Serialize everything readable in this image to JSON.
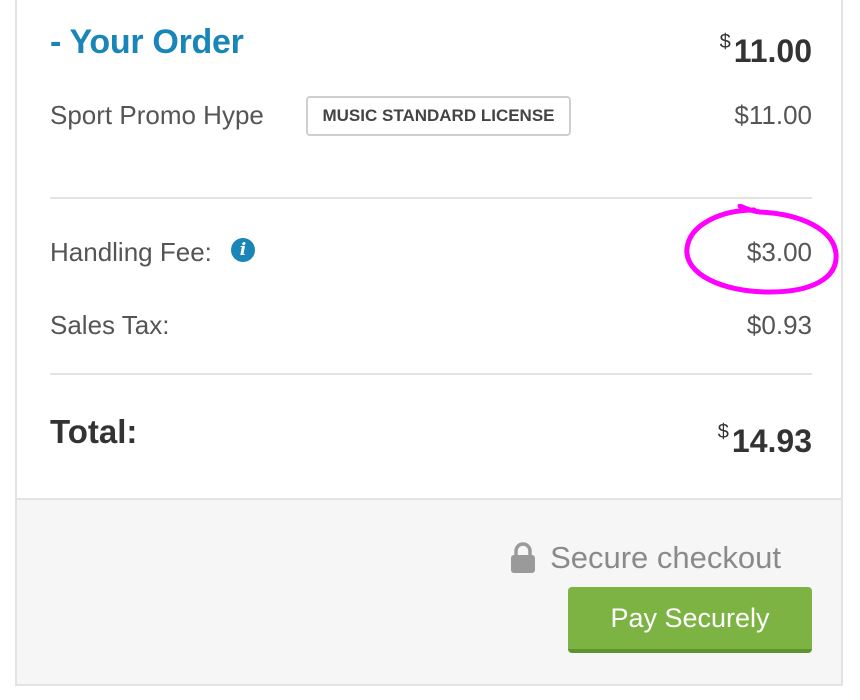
{
  "order": {
    "title": "- Your Order",
    "currency_symbol": "$",
    "header_amount": "11.00"
  },
  "items": [
    {
      "name": "Sport Promo Hype",
      "license": "MUSIC STANDARD LICENSE",
      "price": "$11.00"
    }
  ],
  "fees": {
    "handling_label": "Handling Fee:",
    "handling_value": "$3.00",
    "tax_label": "Sales Tax:",
    "tax_value": "$0.93"
  },
  "total": {
    "label": "Total:",
    "currency_symbol": "$",
    "amount": "14.93"
  },
  "checkout": {
    "secure_label": "Secure checkout",
    "pay_button": "Pay Securely"
  },
  "colors": {
    "accent": "#1a86b8",
    "pay_button": "#7cb342",
    "annotation": "#ff00ff"
  },
  "icons": {
    "info": "info-icon",
    "lock": "lock-icon"
  }
}
